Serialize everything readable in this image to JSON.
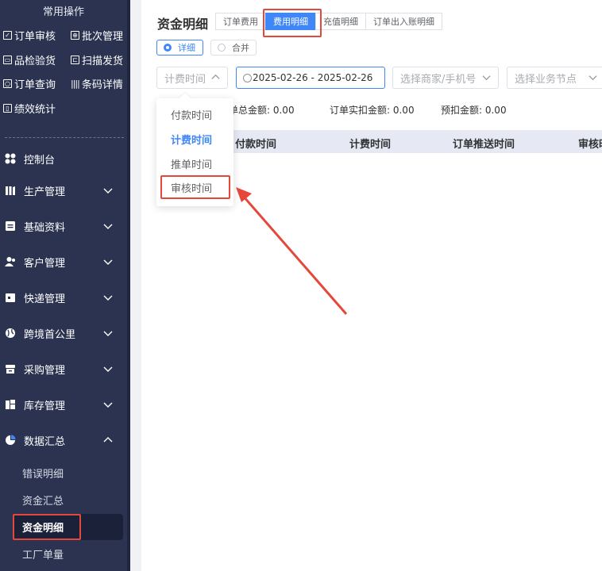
{
  "sidebar": {
    "quick_title": "常用操作",
    "quick_items": [
      {
        "label": "订单审核",
        "icon": "checkbox-icon"
      },
      {
        "label": "批次管理",
        "icon": "batch-icon"
      },
      {
        "label": "品检验货",
        "icon": "inspect-icon"
      },
      {
        "label": "扫描发货",
        "icon": "scan-icon"
      },
      {
        "label": "订单查询",
        "icon": "query-icon"
      },
      {
        "label": "条码详情",
        "icon": "barcode-icon"
      },
      {
        "label": "绩效统计",
        "icon": "stats-icon"
      }
    ],
    "menu": [
      {
        "label": "控制台",
        "icon": "dashboard-icon"
      },
      {
        "label": "生产管理",
        "icon": "production-icon"
      },
      {
        "label": "基础资料",
        "icon": "basic-data-icon"
      },
      {
        "label": "客户管理",
        "icon": "customer-icon"
      },
      {
        "label": "快递管理",
        "icon": "express-icon"
      },
      {
        "label": "跨境首公里",
        "icon": "globe-icon"
      },
      {
        "label": "采购管理",
        "icon": "purchase-icon"
      },
      {
        "label": "库存管理",
        "icon": "inventory-icon"
      },
      {
        "label": "数据汇总",
        "icon": "pie-chart-icon"
      }
    ],
    "sub_items": [
      "错误明细",
      "资金汇总",
      "资金明细",
      "工厂单量"
    ],
    "active_sub": "资金明细"
  },
  "main": {
    "title": "资金明细",
    "tabs": [
      "订单费用",
      "费用明细",
      "充值明细",
      "订单出入账明细"
    ],
    "active_tab": "费用明细",
    "view_modes": [
      "详细",
      "合并"
    ],
    "selected_view": "详细",
    "filters": {
      "time_type": "计费时间",
      "date_range": "2025-02-26  -  2025-02-26",
      "merchant_placeholder": "选择商家/手机号",
      "node_placeholder": "选择业务节点"
    },
    "summary": {
      "order_total": "订单总金额: 0.00",
      "order_actual": "订单实扣金额: 0.00",
      "prededuct": "预扣金额: 0.00"
    },
    "columns": [
      "付款时间",
      "计费时间",
      "订单推送时间",
      "审核时"
    ],
    "time_options": [
      "付款时间",
      "计费时间",
      "推单时间",
      "审核时间"
    ],
    "selected_time_option": "计费时间"
  },
  "colors": {
    "sidebar_bg": "#2b3350",
    "accent": "#3f86f7",
    "highlight_box": "#e5483b"
  }
}
